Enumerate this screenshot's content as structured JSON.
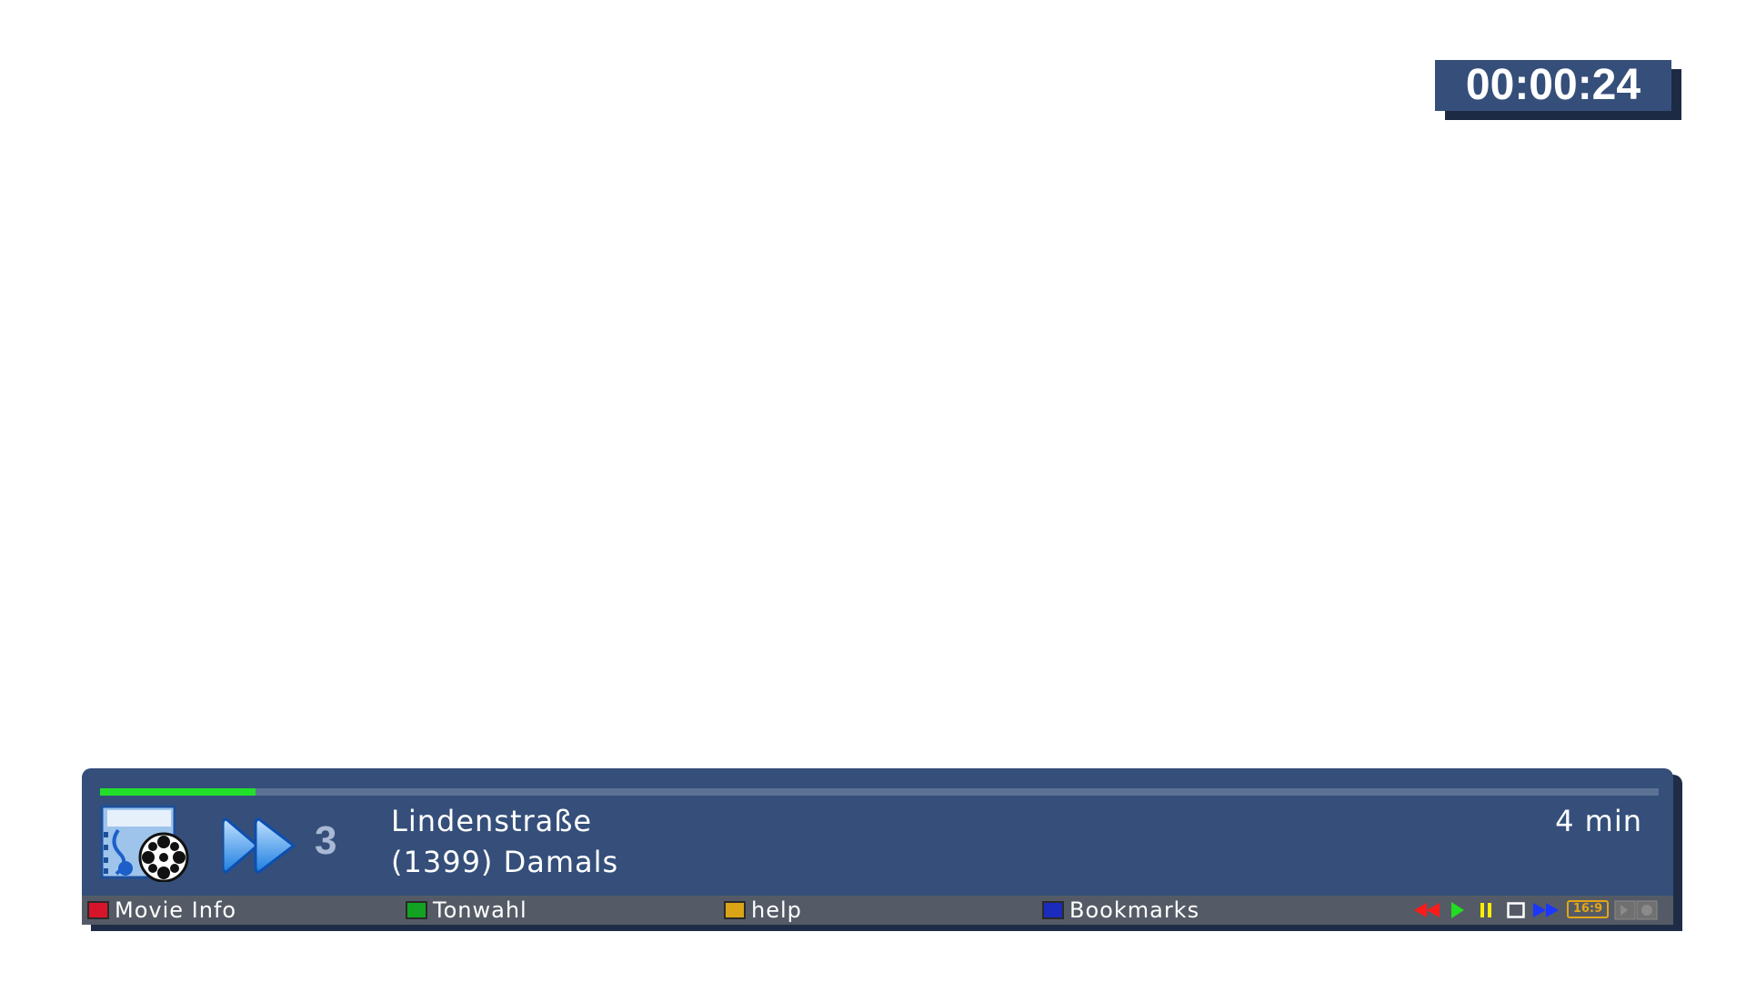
{
  "clock": {
    "time": "00:00:24"
  },
  "infobar": {
    "progress": 0.1,
    "playback_speed": "3",
    "title": "Lindenstraße",
    "subtitle": "(1399) Damals",
    "duration": "4 min",
    "icons": {
      "movie": "movie-reel-icon",
      "mode": "fast-forward-icon"
    },
    "buttons": [
      {
        "color": "#d8142a",
        "label": "Movie Info"
      },
      {
        "color": "#11a321",
        "label": "Tonwahl"
      },
      {
        "color": "#d9a516",
        "label": "help"
      },
      {
        "color": "#1b2bbd",
        "label": "Bookmarks"
      }
    ],
    "status": {
      "aspect_ratio": "16:9",
      "colors": {
        "rewind": "#ff1a1a",
        "play": "#22dd22",
        "pause": "#ffee00",
        "stop": "#ffffff",
        "forward": "#1a36ff",
        "aspect": "#e4a516"
      }
    }
  }
}
